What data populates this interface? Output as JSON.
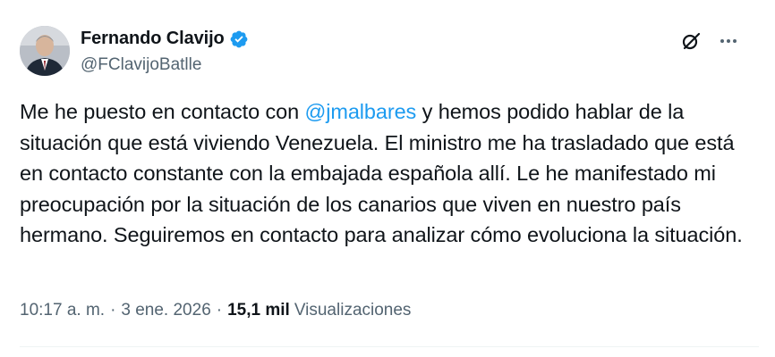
{
  "author": {
    "name": "Fernando Clavijo",
    "handle": "@FClavijoBatlle",
    "verified": true
  },
  "tweet": {
    "text_before": "Me he puesto en contacto con ",
    "mention": "@jmalbares",
    "text_after": " y hemos podido hablar de la situación que está viviendo Venezuela. El ministro me ha trasladado que está en contacto constante con la embajada española allí. Le he manifestado mi preocupación por la situación de los canarios que viven en nuestro país hermano. Seguiremos en contacto para analizar cómo evoluciona la situación."
  },
  "meta": {
    "time": "10:17 a. m.",
    "separator": "·",
    "date": "3 ene. 2026",
    "views_count": "15,1 mil",
    "views_label": "Visualizaciones"
  },
  "icons": {
    "verified": "verified-badge-icon",
    "grok": "grok-icon",
    "more": "more-icon"
  },
  "colors": {
    "accent": "#1d9bf0",
    "text": "#0f1419",
    "secondary": "#536471"
  }
}
